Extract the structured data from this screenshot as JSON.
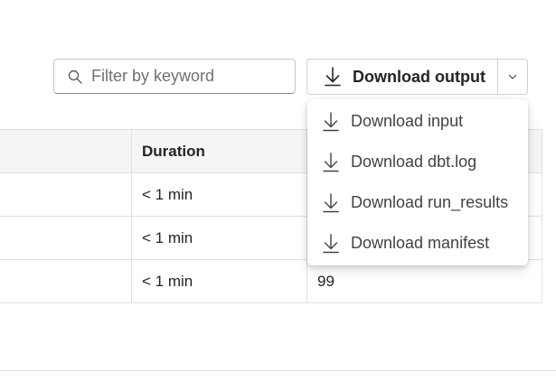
{
  "toolbar": {
    "search": {
      "placeholder": "Filter by keyword",
      "value": "",
      "icon": "search-icon"
    },
    "download_button": {
      "label": "Download output",
      "icon": "download-icon"
    },
    "download_caret": {
      "icon": "chevron-down-icon"
    }
  },
  "download_menu": {
    "items": [
      {
        "label": "Download input",
        "icon": "download-icon"
      },
      {
        "label": "Download dbt.log",
        "icon": "download-icon"
      },
      {
        "label": "Download run_results",
        "icon": "download-icon"
      },
      {
        "label": "Download manifest",
        "icon": "download-icon"
      }
    ]
  },
  "table": {
    "columns": [
      "",
      "Duration",
      ""
    ],
    "rows": [
      [
        "",
        "< 1 min",
        ""
      ],
      [
        "",
        "< 1 min",
        ""
      ],
      [
        "",
        "< 1 min",
        "99"
      ]
    ]
  }
}
